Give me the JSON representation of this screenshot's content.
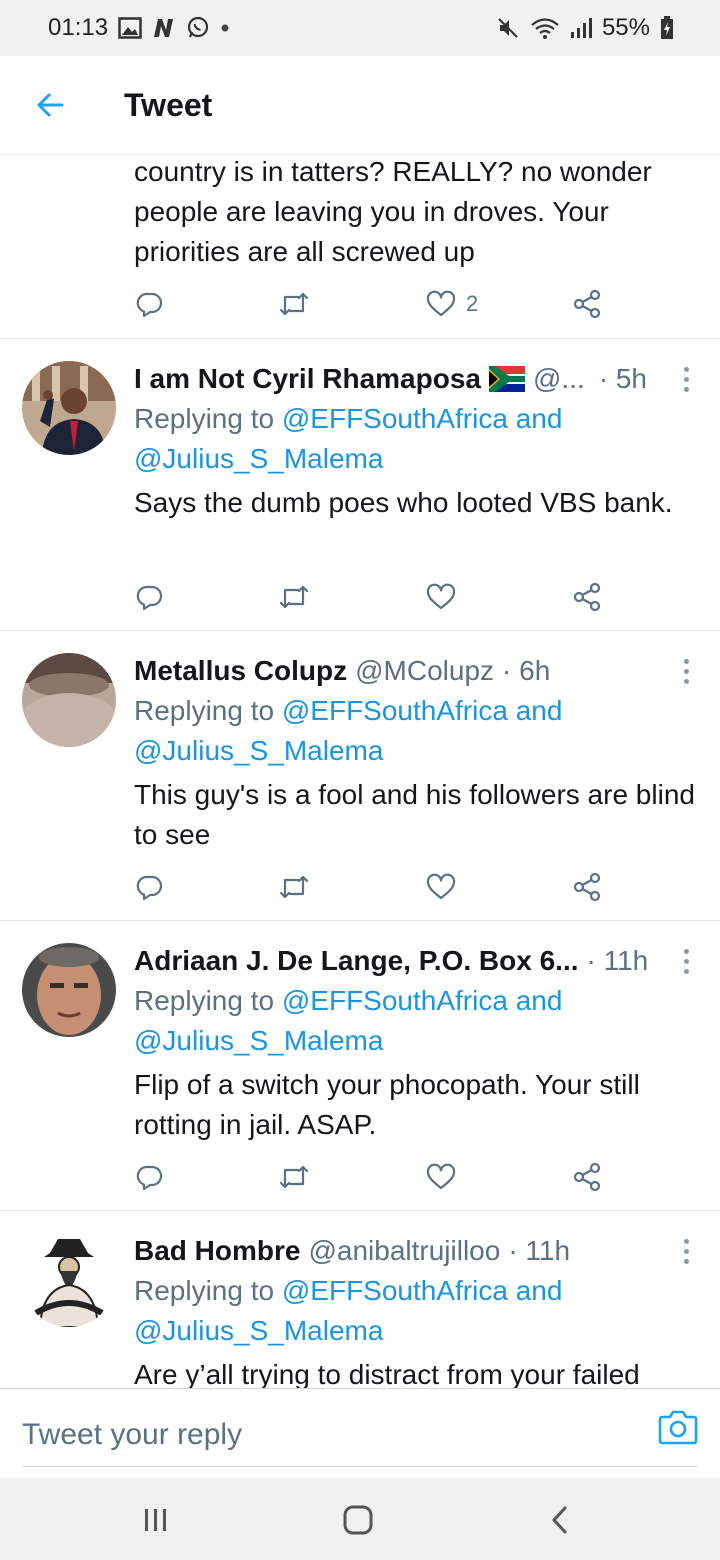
{
  "status_bar": {
    "time": "01:13",
    "battery": "55%",
    "left_icons": [
      "gallery-icon",
      "n-app-icon",
      "whatsapp-icon",
      "dot-icon"
    ],
    "right_icons": [
      "mute-icon",
      "wifi-icon",
      "signal-icon",
      "battery-charging-icon"
    ]
  },
  "header": {
    "back_icon": "arrow-left-icon",
    "title": "Tweet"
  },
  "tweets": [
    {
      "text": "country is in tatters? REALLY? no wonder people are leaving you in droves. Your priorities are all screwed up",
      "like_count": "2"
    },
    {
      "name": "I am Not Cyril Rhamaposa",
      "handle": "@...",
      "time": "· 5h",
      "reply_prefix": "Replying to ",
      "reply_mention1": "@EFFSouthAfrica",
      "reply_and": " and",
      "reply_mention2": "@Julius_S_Malema",
      "text": "Says the dumb poes who looted VBS bank."
    },
    {
      "name": "Metallus Colupz",
      "handle": "@MColupz",
      "time": "· 6h",
      "reply_prefix": "Replying to ",
      "reply_mention1": "@EFFSouthAfrica",
      "reply_and": " and",
      "reply_mention2": "@Julius_S_Malema",
      "text": "This guy's is a fool and his followers are blind to see"
    },
    {
      "name": "Adriaan J. De Lange, P.O. Box 6...",
      "handle": "",
      "time": "· 11h",
      "reply_prefix": "Replying to ",
      "reply_mention1": "@EFFSouthAfrica",
      "reply_and": " and",
      "reply_mention2": "@Julius_S_Malema",
      "text": "Flip of a switch your phocopath. Your still rotting in jail. ASAP."
    },
    {
      "name": "Bad Hombre",
      "handle": "@anibaltrujilloo",
      "time": "· 11h",
      "reply_prefix": "Replying to ",
      "reply_mention1": "@EFFSouthAfrica",
      "reply_and": " and",
      "reply_mention2": "@Julius_S_Malema",
      "text": "Are y’all trying to distract from your failed"
    }
  ],
  "reply_bar": {
    "placeholder": "Tweet your reply",
    "camera_icon": "camera-icon"
  },
  "nav_bar": {
    "icons": [
      "recent-apps-icon",
      "home-icon",
      "back-icon"
    ]
  },
  "colors": {
    "accent": "#1da1f2",
    "mention": "#1b95e0",
    "muted": "#5b7083",
    "flag_green": "#007a4d",
    "flag_red": "#de3831",
    "flag_blue": "#002395",
    "flag_gold": "#ffb612"
  }
}
